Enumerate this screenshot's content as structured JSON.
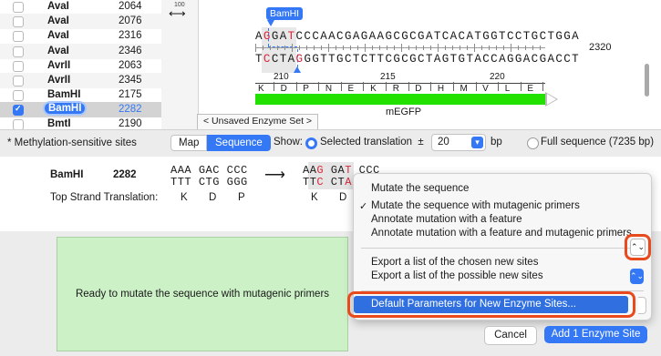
{
  "enzymes": [
    {
      "name": "AvaI",
      "pos": "2064",
      "checked": false
    },
    {
      "name": "AvaI",
      "pos": "2076",
      "checked": false
    },
    {
      "name": "AvaI",
      "pos": "2316",
      "checked": false
    },
    {
      "name": "AvaI",
      "pos": "2346",
      "checked": false
    },
    {
      "name": "AvrII",
      "pos": "2063",
      "checked": false
    },
    {
      "name": "AvrII",
      "pos": "2345",
      "checked": false
    },
    {
      "name": "BamHI",
      "pos": "2175",
      "checked": false
    },
    {
      "name": "BamHI",
      "pos": "2282",
      "checked": true
    },
    {
      "name": "BmtI",
      "pos": "2190",
      "checked": false
    }
  ],
  "map": {
    "zoom_value": "100",
    "enzyme_label": "BamHI",
    "top_strand": {
      "pre": "A",
      "r1": "G",
      "mid1": "GA",
      "r2": "T",
      "post": "CCCAACGAGAAGCGCGATCACATGGTCCTGCTGGA"
    },
    "bottom_strand": {
      "pre": "T",
      "r1": "C",
      "mid1": "CTA",
      "r2": "G",
      "post": "GGTTGCTCTTCGCGCTAGTGTACCAGGACGACCT"
    },
    "end_position": "2320",
    "ruler": [
      "210",
      "215",
      "220"
    ],
    "aa": [
      "K",
      "D",
      "P",
      "N",
      "E",
      "K",
      "R",
      "D",
      "H",
      "M",
      "V",
      "L",
      "E"
    ],
    "feature_name": "mEGFP",
    "feature_color": "#22e000",
    "enzyme_set_tab": "< Unsaved Enzyme Set >"
  },
  "toolbar": {
    "methylation_note": "* Methylation-sensitive sites",
    "tab_map": "Map",
    "tab_sequence": "Sequence",
    "show_label": "Show:",
    "selected_translation": "Selected translation  ±",
    "flank_value": "20",
    "bp_label": "bp",
    "full_sequence": "Full sequence (7235 bp)"
  },
  "detail": {
    "enzyme": "BamHI",
    "position": "2282",
    "orig_top": [
      "AAA",
      "GAC",
      "CCC"
    ],
    "orig_bottom": [
      "TTT",
      "CTG",
      "GGG"
    ],
    "new_top": [
      "AAG",
      "GAT",
      "CCC"
    ],
    "new_bottom": [
      "TTC",
      "CTA",
      "GGG"
    ],
    "translation_label": "Top Strand Translation:",
    "orig_aa": [
      "K",
      "D",
      "P"
    ],
    "new_aa": [
      "K",
      "D",
      "P"
    ]
  },
  "status": "Ready to mutate the sequence with mutagenic primers",
  "menu": {
    "items": [
      {
        "label": "Mutate the sequence",
        "checked": false
      },
      {
        "label": "Mutate the sequence with mutagenic primers",
        "checked": true
      },
      {
        "label": "Annotate mutation with a feature",
        "checked": false
      },
      {
        "label": "Annotate mutation with a feature and mutagenic primers",
        "checked": false
      }
    ],
    "export_items": [
      "Export a list of the chosen new sites",
      "Export a list of the possible new sites"
    ],
    "highlighted": "Default Parameters for New Enzyme Sites...",
    "check_glyph": "✓"
  },
  "buttons": {
    "cancel": "Cancel",
    "add": "Add 1 Enzyme Site"
  },
  "colors": {
    "accent": "#3478f6",
    "status_bg": "#ccf1c6",
    "highlight_ring": "#e84a1e"
  }
}
